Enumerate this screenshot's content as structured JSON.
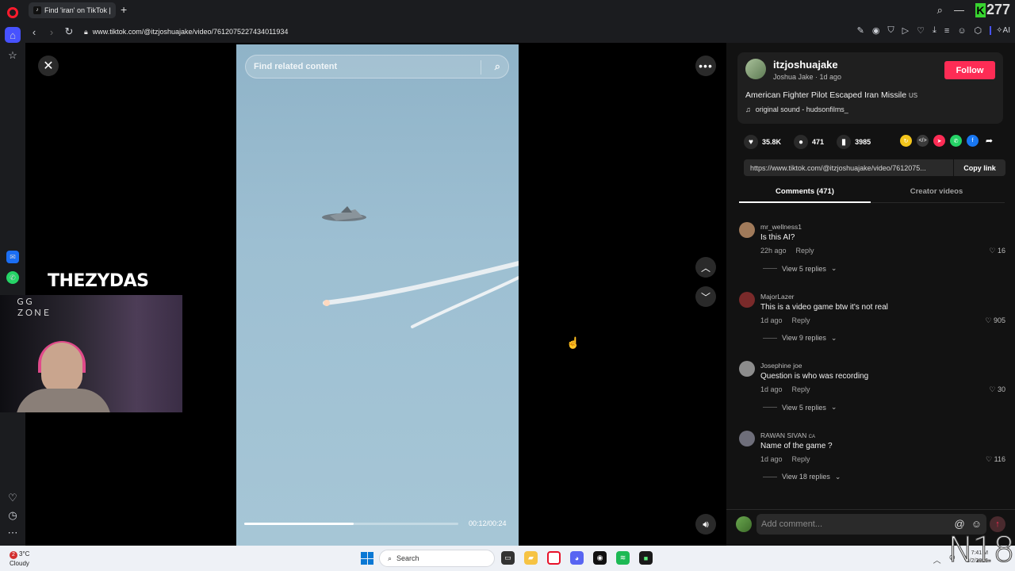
{
  "browser": {
    "tab_title": "Find 'iran' on TikTok |",
    "tab_favicon": "♪",
    "new_tab": "+",
    "url": "www.tiktok.com/@itzjoshuajake/video/7612075227434011934",
    "ai_label": "AI",
    "overlay_counter_k": "K",
    "overlay_counter": "277"
  },
  "video": {
    "search_placeholder": "Find related content",
    "progress_fraction": 0.51,
    "time": "00:12/00:24"
  },
  "stream_overlay": {
    "streamer_name": "THEZYDAS",
    "wall_text": "ＧＧ\nＺＯＮＥ",
    "watermark": "N18"
  },
  "creator": {
    "username": "itzjoshuajake",
    "display": "Joshua Jake · 1d ago",
    "follow_label": "Follow",
    "video_title": "American Fighter Pilot Escaped Iran Missile",
    "video_title_flag": "US",
    "sound": "original sound - hudsonfilms_"
  },
  "stats": {
    "likes": "35.8K",
    "comments": "471",
    "saves": "3985"
  },
  "share": {
    "link": "https://www.tiktok.com/@itzjoshuajake/video/7612075...",
    "copy_label": "Copy link"
  },
  "tabs": {
    "comments": "Comments (471)",
    "creator_videos": "Creator videos"
  },
  "comments": [
    {
      "user": "mr_wellness1",
      "text": "Is this AI?",
      "age": "22h ago",
      "reply": "Reply",
      "likes": "16",
      "replies": "View 5 replies",
      "avatar_color": "#a07a5a"
    },
    {
      "user": "MajorLazer",
      "text": "This is a video game btw it's not real",
      "age": "1d ago",
      "reply": "Reply",
      "likes": "905",
      "replies": "View 9 replies",
      "avatar_color": "#7a2a2a"
    },
    {
      "user": "Josephine joe",
      "text": "Question is who was recording",
      "age": "1d ago",
      "reply": "Reply",
      "likes": "30",
      "replies": "View 5 replies",
      "avatar_color": "#8c8c8c"
    },
    {
      "user": "RAWAN SIVAN",
      "user_flag": "CA",
      "text": "Name of the game ?",
      "age": "1d ago",
      "reply": "Reply",
      "likes": "116",
      "replies": "View 18 replies",
      "avatar_color": "#6e6e7a"
    }
  ],
  "add_comment": {
    "placeholder": "Add comment..."
  },
  "taskbar": {
    "weather_temp": "3°C",
    "weather_desc": "Cloudy",
    "weather_badge": "2",
    "search_label": "Search",
    "clock_time": "7:41",
    "clock_date": "3/2/2026",
    "clock_extra": "M"
  },
  "colors": {
    "accent_follow": "#fe2c55",
    "opera_red": "#ff1b2d",
    "opera_blue": "#4752ff"
  }
}
